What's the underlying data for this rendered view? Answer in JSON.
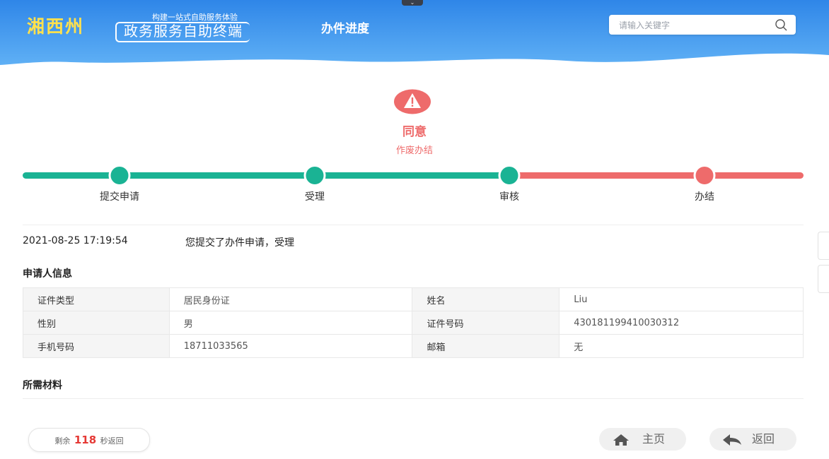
{
  "header": {
    "logo_main": "湘西州",
    "logo_tagline": "构建一站式自助服务体验",
    "logo_sub": "政务服务自助终端",
    "page_title": "办件进度",
    "search_placeholder": "请输入关键字"
  },
  "status": {
    "icon": "warning-icon",
    "title": "同意",
    "subtitle": "作废办结",
    "accent_color": "#ee6b6b"
  },
  "progress": {
    "steps": [
      {
        "label": "提交申请",
        "state": "done"
      },
      {
        "label": "受理",
        "state": "done"
      },
      {
        "label": "审核",
        "state": "done"
      },
      {
        "label": "办结",
        "state": "error"
      }
    ],
    "done_color": "#1ab394",
    "error_color": "#ee6b6b"
  },
  "log": {
    "time": "2021-08-25 17:19:54",
    "text": "您提交了办件申请，受理"
  },
  "applicant": {
    "section_title": "申请人信息",
    "rows": [
      [
        {
          "k": "证件类型",
          "v": "居民身份证"
        },
        {
          "k": "姓名",
          "v": "Liu"
        }
      ],
      [
        {
          "k": "性别",
          "v": "男"
        },
        {
          "k": "证件号码",
          "v": "430181199410030312"
        }
      ],
      [
        {
          "k": "手机号码",
          "v": "18711033565"
        },
        {
          "k": "邮箱",
          "v": "无"
        }
      ]
    ]
  },
  "materials": {
    "section_title": "所需材料"
  },
  "footer": {
    "countdown_prefix": "剩余",
    "countdown_value": "118",
    "countdown_suffix": "秒返回",
    "home_label": "主页",
    "back_label": "返回"
  }
}
